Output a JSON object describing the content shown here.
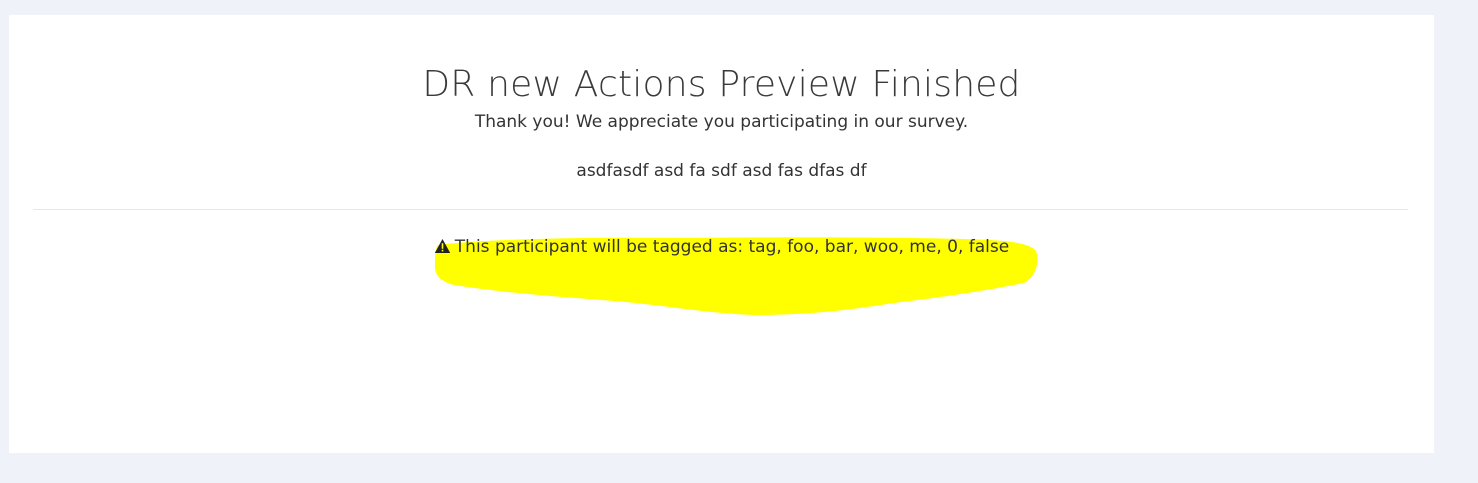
{
  "page": {
    "title": "DR new Actions Preview Finished",
    "thanks_message": "Thank you! We appreciate you participating in our survey.",
    "extra_text": "asdfasdf asd fa sdf asd fas dfas df",
    "tag_notice": "This participant will be tagged as: tag, foo, bar, woo, me, 0, false",
    "tag_notice_icon": "warning-triangle-icon"
  },
  "colors": {
    "background": "#eff2f9",
    "card": "#ffffff",
    "highlight": "#ffff00",
    "text": "#333333"
  }
}
